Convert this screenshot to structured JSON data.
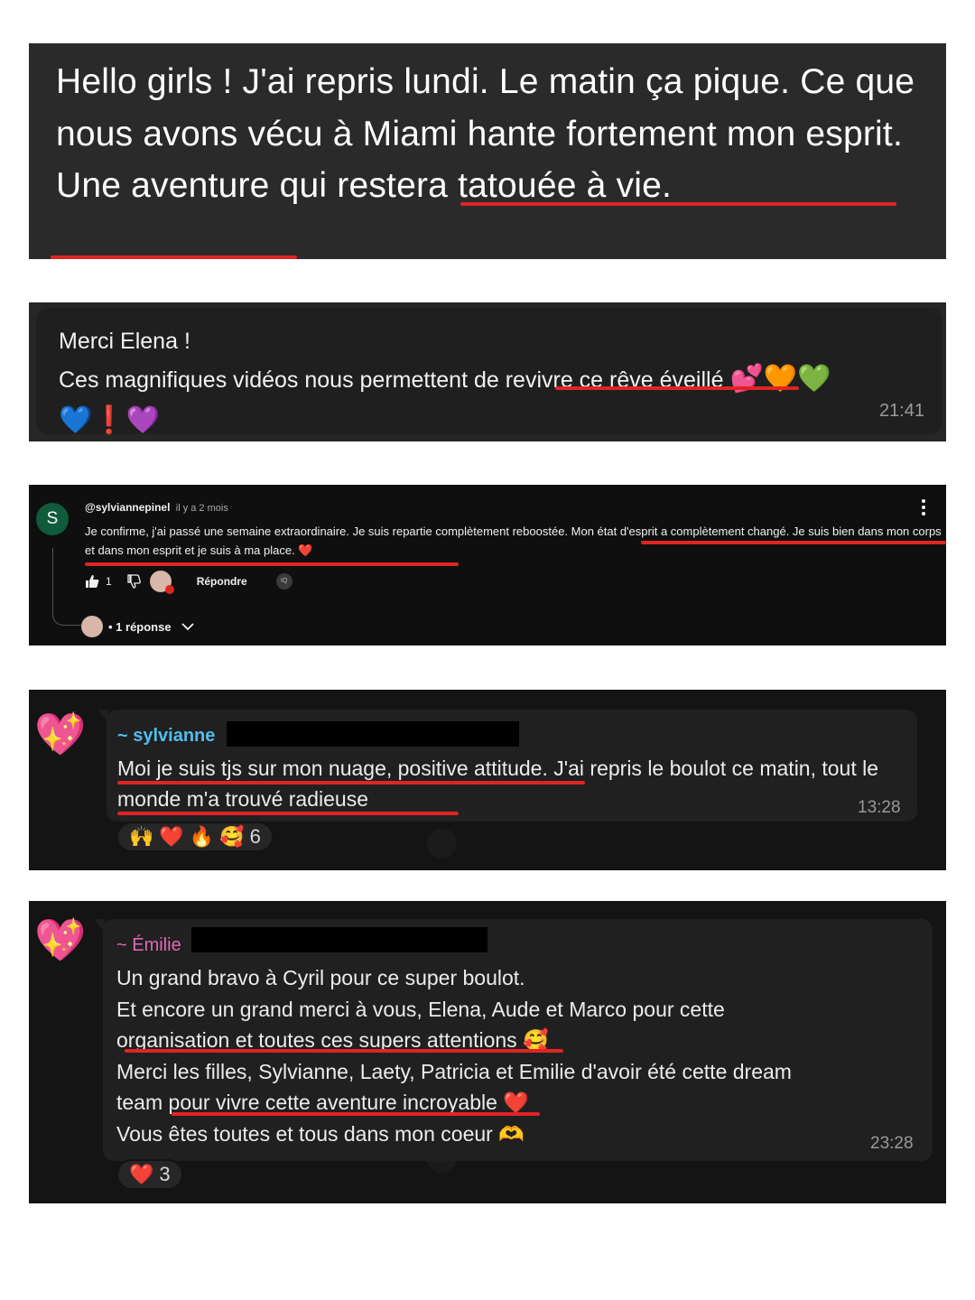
{
  "card1": {
    "text": "Hello girls ! J'ai repris lundi. Le matin ça pique. Ce que nous avons vécu à Miami hante fortement mon esprit. Une aventure qui restera tatouée à vie."
  },
  "card2": {
    "line1": "Merci Elena !",
    "line2": "Ces magnifiques vidéos nous permettent de revivre ce rêve éveillé",
    "emojis_line2": "💕🧡💚",
    "emojis_line3": "💙❗💜",
    "time": "21:41"
  },
  "card3": {
    "avatar_letter": "S",
    "handle": "@sylviannepinel",
    "date": "il y a 2 mois",
    "text": "Je confirme, j'ai passé une semaine extraordinaire. Je suis repartie complètement reboostée. Mon état d'esprit a complètement changé. Je suis bien dans mon corps et dans mon esprit et je suis à ma place.",
    "text_emoji": "❤️",
    "like_count": "1",
    "reply_label": "Répondre",
    "badge": "IQ",
    "replies_label": "• 1 réponse"
  },
  "card4": {
    "avatar_emoji": "💖",
    "sender": "~ sylvianne",
    "text": "Moi je suis tjs sur mon nuage, positive attitude. J'ai repris le boulot ce matin, tout le monde m'a trouvé radieuse",
    "time": "13:28",
    "reactions": [
      "🙌",
      "❤️",
      "🔥",
      "🥰"
    ],
    "reaction_count": "6"
  },
  "card5": {
    "avatar_emoji": "💖",
    "sender": "~ Émilie",
    "lines": [
      "Un grand bravo à Cyril pour ce super boulot.",
      "Et encore un grand merci à vous, Elena, Aude et Marco pour cette",
      "organisation et toutes ces supers attentions 🥰",
      "Merci les filles, Sylvianne, Laety, Patricia et Emilie d'avoir été cette dream",
      "team pour vivre cette aventure incroyable ❤️",
      "Vous êtes toutes et tous dans mon coeur 🫶"
    ],
    "time": "23:28",
    "reactions": [
      "❤️"
    ],
    "reaction_count": "3"
  }
}
